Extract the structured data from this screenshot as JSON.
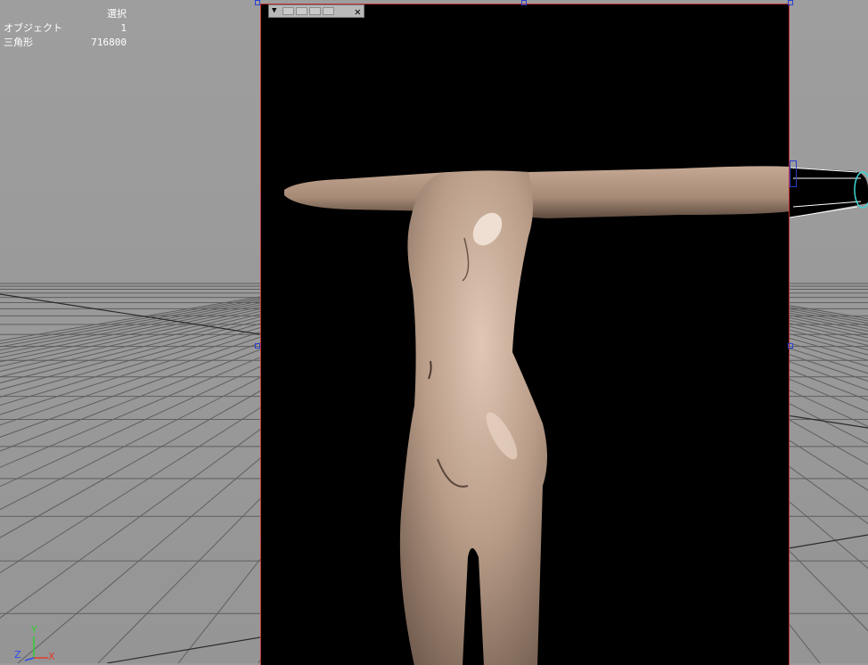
{
  "hud": {
    "title": "選択",
    "rows": [
      {
        "label": "オブジェクト",
        "value": "1"
      },
      {
        "label": "三角形",
        "value": "716800"
      }
    ]
  },
  "render_window": {
    "toolbar_icons": [
      "dropdown-arrow-icon",
      "render-button",
      "render-button",
      "render-button",
      "render-button",
      "close-icon"
    ],
    "close_glyph": "✕",
    "arrow_glyph": "▼"
  },
  "axis": {
    "y": "Y",
    "z": "Z",
    "x": "X"
  },
  "colors": {
    "viewport_bg": "#9b9b9b",
    "grid": "#5d5d5d",
    "window_border": "#c0302f",
    "handle": "#2a3fd0",
    "skin": "#c6a994"
  }
}
